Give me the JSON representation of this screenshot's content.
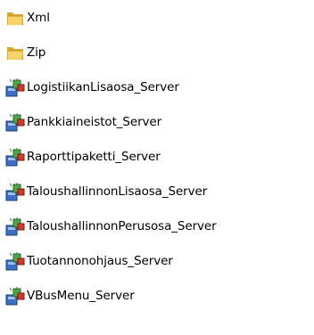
{
  "items": [
    {
      "label": "Xml",
      "icon": "folder-icon"
    },
    {
      "label": "Zip",
      "icon": "folder-icon"
    },
    {
      "label": "LogistiikanLisaosa_Server",
      "icon": "setup-installer-icon"
    },
    {
      "label": "Pankkiaineistot_Server",
      "icon": "setup-installer-icon"
    },
    {
      "label": "Raporttipaketti_Server",
      "icon": "setup-installer-icon"
    },
    {
      "label": "TaloushallinnonLisaosa_Server",
      "icon": "setup-installer-icon"
    },
    {
      "label": "TaloushallinnonPerusosa_Server",
      "icon": "setup-installer-icon"
    },
    {
      "label": "Tuotannonohjaus_Server",
      "icon": "setup-installer-icon"
    },
    {
      "label": "VBusMenu_Server",
      "icon": "setup-installer-icon"
    }
  ],
  "colors": {
    "folder_back": "#d9a92b",
    "folder_front": "#f6d36a",
    "installer_blue": "#3a6fc4",
    "installer_green": "#4aa84a",
    "installer_red": "#d23a2a",
    "text": "#000000",
    "background": "#ffffff"
  }
}
